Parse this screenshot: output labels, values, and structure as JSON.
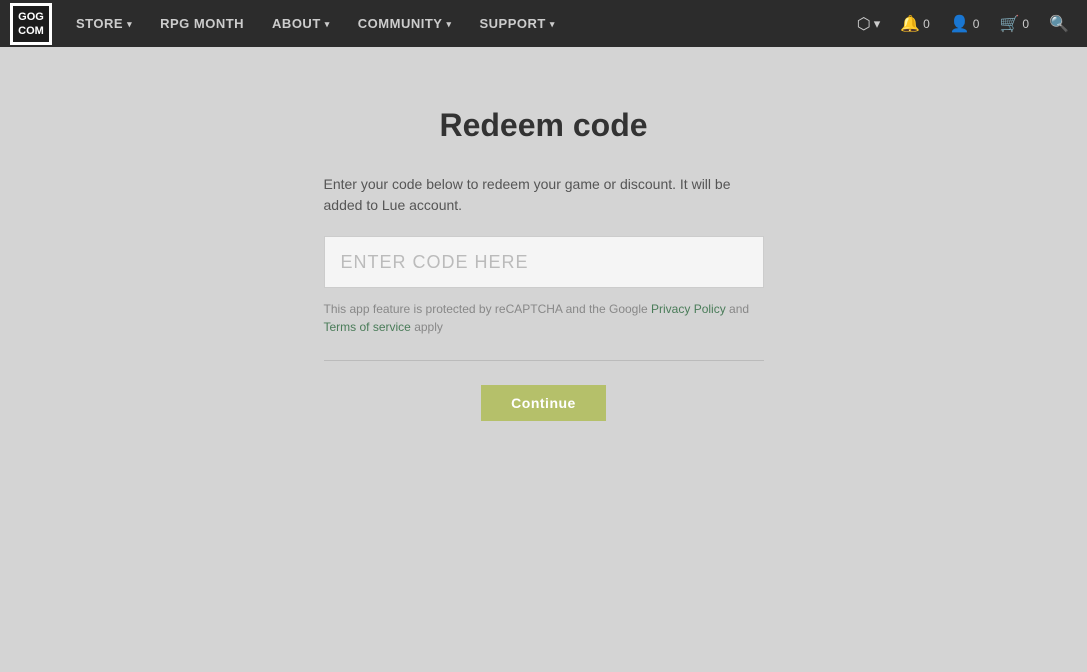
{
  "navbar": {
    "logo_text_top": "GOG",
    "logo_text_bottom": "COM",
    "items": [
      {
        "label": "STORE",
        "has_dropdown": true
      },
      {
        "label": "RPG MONTH",
        "has_dropdown": false
      },
      {
        "label": "ABOUT",
        "has_dropdown": true
      },
      {
        "label": "COMMUNITY",
        "has_dropdown": true
      },
      {
        "label": "SUPPORT",
        "has_dropdown": true
      }
    ],
    "right_icons": [
      {
        "name": "notifications",
        "symbol": "🔔",
        "count": "0"
      },
      {
        "name": "user",
        "symbol": "👤",
        "count": "0"
      },
      {
        "name": "cart",
        "symbol": "🛒",
        "count": "0"
      },
      {
        "name": "search",
        "symbol": "🔍",
        "count": ""
      }
    ],
    "galaxy_icon": "🌐"
  },
  "main": {
    "page_title": "Redeem code",
    "description_part1": "Enter your code below to redeem your game or discount. It will be added to Lue account.",
    "code_input_placeholder": "ENTER CODE HERE",
    "recaptcha_text_before": "This app feature is protected by reCAPTCHA and the Google ",
    "privacy_policy_label": "Privacy Policy",
    "recaptcha_and": " and ",
    "terms_label": "Terms of service",
    "recaptcha_after": " apply",
    "continue_button_label": "Continue"
  }
}
